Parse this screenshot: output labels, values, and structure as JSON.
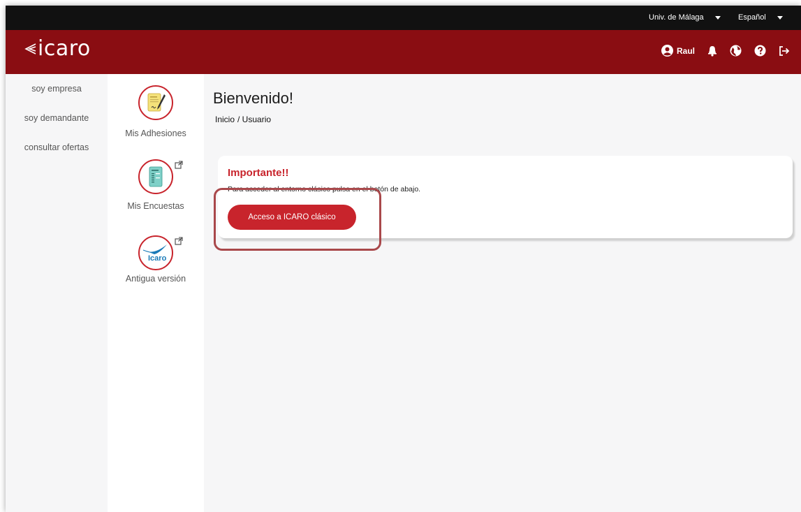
{
  "topbar": {
    "university": "Univ. de Málaga",
    "language": "Español"
  },
  "header": {
    "logo_text": "icaro",
    "user_name": "Raul",
    "icons": [
      "user-circle-icon",
      "bell-icon",
      "globe-icon",
      "help-icon",
      "logout-icon"
    ]
  },
  "sidebar": {
    "items": [
      {
        "label": "soy empresa"
      },
      {
        "label": "soy demandante"
      },
      {
        "label": "consultar ofertas"
      }
    ]
  },
  "iconcol": {
    "items": [
      {
        "label": "Mis Adhesiones",
        "icon": "document-sign-icon",
        "external": false
      },
      {
        "label": "Mis Encuestas",
        "icon": "survey-icon",
        "external": true
      },
      {
        "label": "Antigua versión",
        "icon": "icaro-logo-icon",
        "external": true,
        "logo_text": "Icaro"
      }
    ]
  },
  "main": {
    "title": "Bienvenido!",
    "breadcrumb": [
      "Inicio",
      "/ Usuario"
    ],
    "card": {
      "title": "Importante!!",
      "text": "Para acceder al entorno clásico pulsa en el botón de abajo.",
      "button_label": "Acceso a ICARO clásico"
    }
  },
  "colors": {
    "header_bg": "#8a0d12",
    "accent": "#c8242c",
    "topbar_bg": "#111111"
  }
}
